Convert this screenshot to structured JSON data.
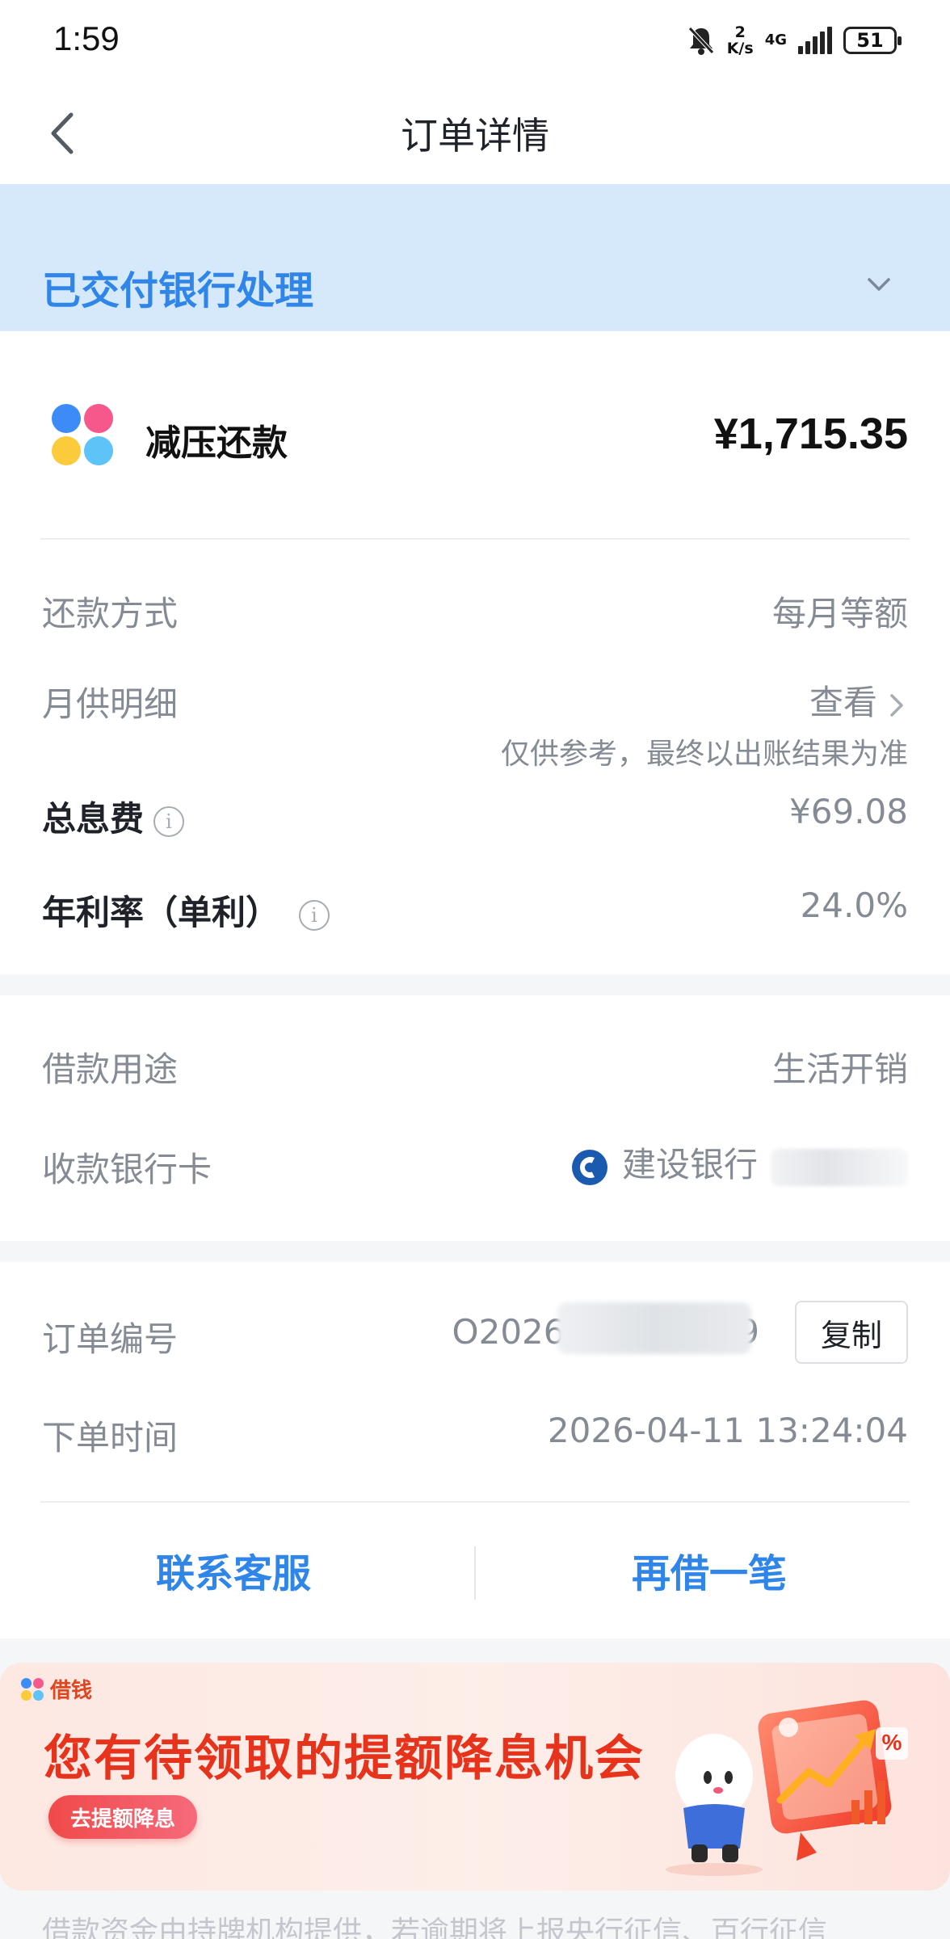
{
  "status_bar": {
    "time": "1:59",
    "speed_value": "2",
    "speed_unit": "K/s",
    "network": "4G",
    "battery": "51"
  },
  "nav": {
    "title": "订单详情",
    "back_icon": "chevron-left-icon"
  },
  "order_status": {
    "text": "已交付银行处理",
    "expand_icon": "chevron-down-icon"
  },
  "product": {
    "name": "减压还款",
    "amount": "¥1,715.35",
    "logo_colors": [
      "#3d8bf7",
      "#f7588b",
      "#fbcb3c",
      "#5ec4f7"
    ]
  },
  "details": {
    "repay_method_label": "还款方式",
    "repay_method_value": "每月等额",
    "monthly_label": "月供明细",
    "monthly_value": "查看",
    "monthly_note": "仅供参考，最终以出账结果为准",
    "interest_label": "总息费",
    "interest_value": "¥69.08",
    "rate_label": "年利率（单利）",
    "rate_value": "24.0%"
  },
  "loan": {
    "purpose_label": "借款用途",
    "purpose_value": "生活开销",
    "card_label": "收款银行卡",
    "bank_name": "建设银行"
  },
  "order": {
    "number_label": "订单编号",
    "number_value": "O2026041162889",
    "copy_label": "复制",
    "time_label": "下单时间",
    "time_value": "2026-04-11 13:24:04"
  },
  "actions": {
    "contact": "联系客服",
    "borrow_again": "再借一笔"
  },
  "promo": {
    "tag": "借钱",
    "title": "您有待领取的提额降息机会",
    "button": "去提额降息",
    "percent_sign": "%"
  },
  "footer": {
    "note": "借款资金由持牌机构提供，若逾期将上报央行征信、百行征信"
  },
  "colors": {
    "accent": "#2f86e8",
    "banner_bg": "#d5e9fa",
    "promo_red": "#e8331c"
  }
}
